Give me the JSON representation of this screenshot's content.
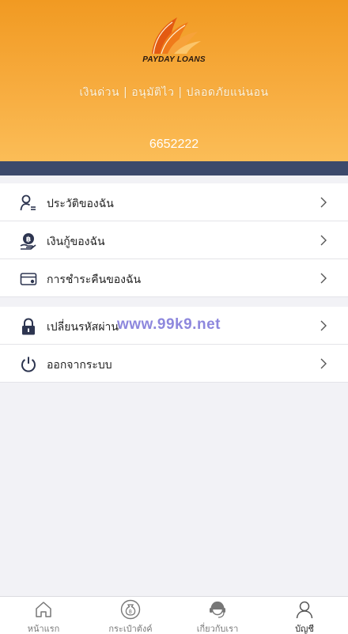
{
  "header": {
    "logo_text": "PAYDAY LOANS",
    "tagline": "เงินด่วน | อนุมัติไว | ปลอดภัยแน่นอน",
    "account_id": "6652222"
  },
  "menu": {
    "group1": [
      {
        "label": "ประวัติของฉัน",
        "icon": "user-list-icon"
      },
      {
        "label": "เงินกู้ของฉัน",
        "icon": "baht-coin-hand-icon"
      },
      {
        "label": "การชำระคืนของฉัน",
        "icon": "card-icon"
      }
    ],
    "group2": [
      {
        "label": "เปลี่ยนรหัสผ่าน",
        "icon": "lock-icon"
      },
      {
        "label": "ออกจากระบบ",
        "icon": "power-icon"
      }
    ]
  },
  "watermark": "www.99k9.net",
  "tabbar": {
    "tabs": [
      {
        "label": "หน้าแรก",
        "icon": "home-icon"
      },
      {
        "label": "กระเป๋าตังค์",
        "icon": "money-bag-icon"
      },
      {
        "label": "เกี่ยวกับเรา",
        "icon": "support-agent-icon"
      },
      {
        "label": "บัญชี",
        "icon": "account-icon",
        "active": true
      }
    ]
  },
  "colors": {
    "header_top": "#f19a22",
    "header_bottom": "#fbbd57",
    "bar": "#3c4a6b",
    "icon": "#2d3550"
  }
}
